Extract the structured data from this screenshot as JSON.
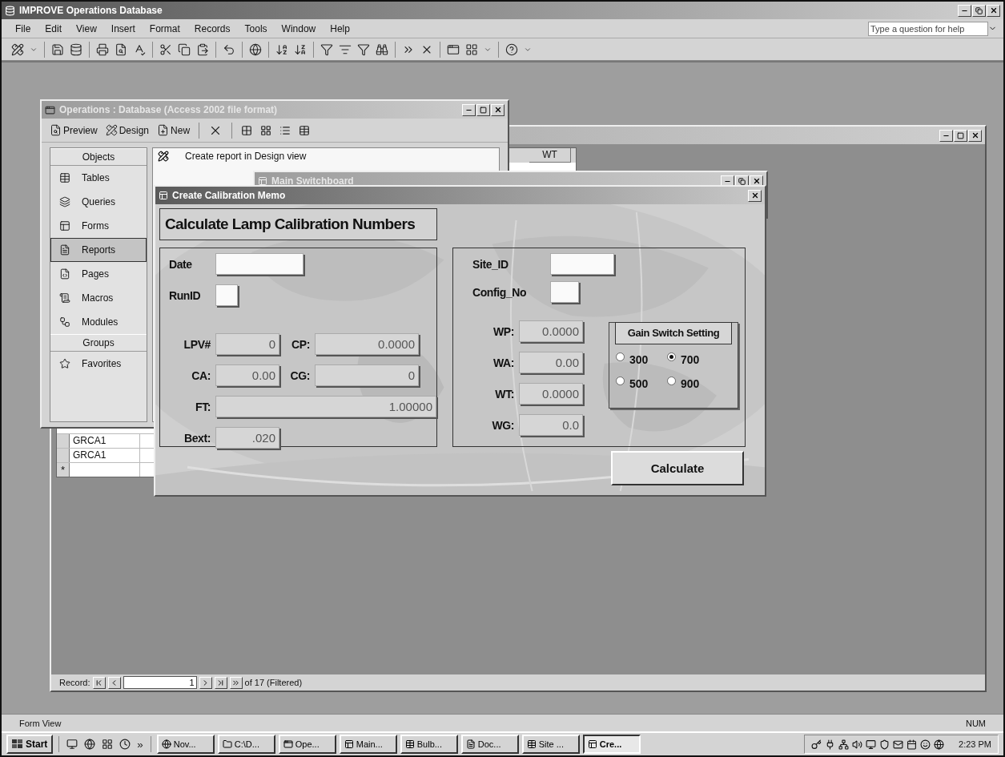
{
  "app": {
    "title": "IMPROVE Operations Database",
    "help_placeholder": "Type a question for help",
    "menu": [
      "File",
      "Edit",
      "View",
      "Insert",
      "Format",
      "Records",
      "Tools",
      "Window",
      "Help"
    ]
  },
  "datasheet": {
    "column_header": "WT",
    "rows": [
      {
        "cell": "GRCA1"
      },
      {
        "cell": "GRCA1"
      }
    ],
    "new_row_marker": "*",
    "record_nav": {
      "label": "Record:",
      "current": "1",
      "total": "of 17 (Filtered)"
    }
  },
  "database_window": {
    "title": "Operations : Database (Access 2002 file format)",
    "toolbar": [
      "Preview",
      "Design",
      "New"
    ],
    "groups": [
      {
        "header": "Objects",
        "items": [
          {
            "label": "Tables",
            "selected": false
          },
          {
            "label": "Queries",
            "selected": false
          },
          {
            "label": "Forms",
            "selected": false
          },
          {
            "label": "Reports",
            "selected": true
          },
          {
            "label": "Pages",
            "selected": false
          },
          {
            "label": "Macros",
            "selected": false
          },
          {
            "label": "Modules",
            "selected": false
          }
        ]
      },
      {
        "header": "Groups",
        "items": [
          {
            "label": "Favorites",
            "selected": false
          }
        ]
      }
    ],
    "list": [
      "Create report in Design view"
    ]
  },
  "switchboard": {
    "title": "Main Switchboard"
  },
  "calibration": {
    "title": "Create Calibration Memo",
    "heading": "Calculate Lamp Calibration Numbers",
    "left_fields": [
      {
        "label": "Date",
        "kind": "input"
      },
      {
        "label": "RunID",
        "kind": "input"
      },
      {
        "label": "LPV#",
        "kind": "readout",
        "value": "0"
      },
      {
        "label": "CP:",
        "kind": "readout",
        "value": "0.0000"
      },
      {
        "label": "CA:",
        "kind": "readout",
        "value": "0.00"
      },
      {
        "label": "CG:",
        "kind": "readout",
        "value": "0"
      },
      {
        "label": "FT:",
        "kind": "readout",
        "value": "1.00000"
      },
      {
        "label": "Bext:",
        "kind": "readout",
        "value": ".020"
      }
    ],
    "right_fields": [
      {
        "label": "Site_ID",
        "kind": "input"
      },
      {
        "label": "Config_No",
        "kind": "input"
      }
    ],
    "readings": [
      {
        "label": "WP:",
        "value": "0.0000"
      },
      {
        "label": "WA:",
        "value": "0.00"
      },
      {
        "label": "WT:",
        "value": "0.0000"
      },
      {
        "label": "WG:",
        "value": "0.0"
      }
    ],
    "gain": {
      "legend": "Gain Switch Setting",
      "options": [
        {
          "label": "300",
          "selected": false
        },
        {
          "label": "700",
          "selected": true
        },
        {
          "label": "500",
          "selected": false
        },
        {
          "label": "900",
          "selected": false
        }
      ]
    },
    "button": "Calculate"
  },
  "status_bar": {
    "left": "Form View",
    "right": "NUM"
  },
  "taskbar": {
    "start": "Start",
    "more": "»",
    "tasks": [
      {
        "label": "Nov...",
        "selected": false
      },
      {
        "label": "C:\\D...",
        "selected": false
      },
      {
        "label": "Ope...",
        "selected": false
      },
      {
        "label": "Main...",
        "selected": false
      },
      {
        "label": "Bulb...",
        "selected": false
      },
      {
        "label": "Doc...",
        "selected": false
      },
      {
        "label": "Site ...",
        "selected": false
      },
      {
        "label": "Cre...",
        "selected": true
      }
    ],
    "clock": "2:23 PM"
  }
}
